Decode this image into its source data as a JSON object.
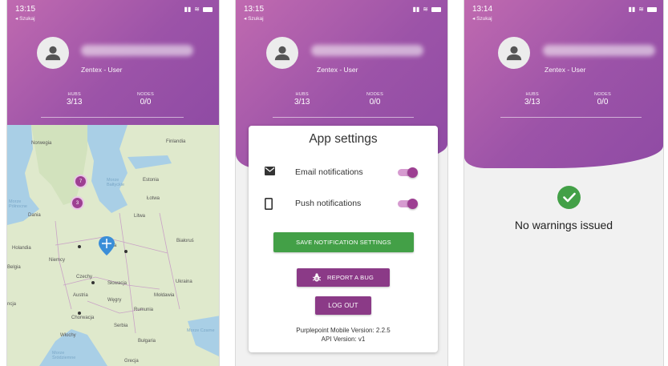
{
  "profile": {
    "role": "Zentex - User",
    "hubs_label": "HUBS",
    "hubs_value": "3/13",
    "nodes_label": "NODES",
    "nodes_value": "0/0"
  },
  "screens": [
    {
      "time": "13:15",
      "back": "◂ Szukaj"
    },
    {
      "time": "13:15",
      "back": "◂ Szukaj"
    },
    {
      "time": "13:14",
      "back": "◂ Szukaj"
    }
  ],
  "map": {
    "labels": [
      "Norwegia",
      "Finlandia",
      "Morze Bałtyckie",
      "Estonia",
      "Łotwa",
      "Morze Północne",
      "Dania",
      "Litwa",
      "Holandia",
      "Niemcy",
      "Białoruś",
      "Belgia",
      "Czechy",
      "Słowacja",
      "Ukraina",
      "Austria",
      "Węgry",
      "Mołdawia",
      "ncja",
      "Rumunia",
      "Chorwacja",
      "Serbia",
      "Morze Czarne",
      "Włochy",
      "Bułgaria",
      "Morze Śródziemne",
      "Grecja",
      "ka"
    ],
    "clusters": [
      "7",
      "3"
    ]
  },
  "settings": {
    "title": "App settings",
    "email_label": "Email notifications",
    "email_enabled": true,
    "push_label": "Push notifications",
    "push_enabled": true,
    "save_button": "SAVE NOTIFICATION SETTINGS",
    "bug_button": "REPORT A BUG",
    "logout_button": "LOG OUT",
    "version_line": "Purplepoint Mobile Version: 2.2.5",
    "api_line": "API Version: v1"
  },
  "warnings": {
    "message": "No warnings issued"
  },
  "colors": {
    "header_purple": "#9c53a8",
    "accent_purple": "#8b3a87",
    "green": "#43a047"
  }
}
